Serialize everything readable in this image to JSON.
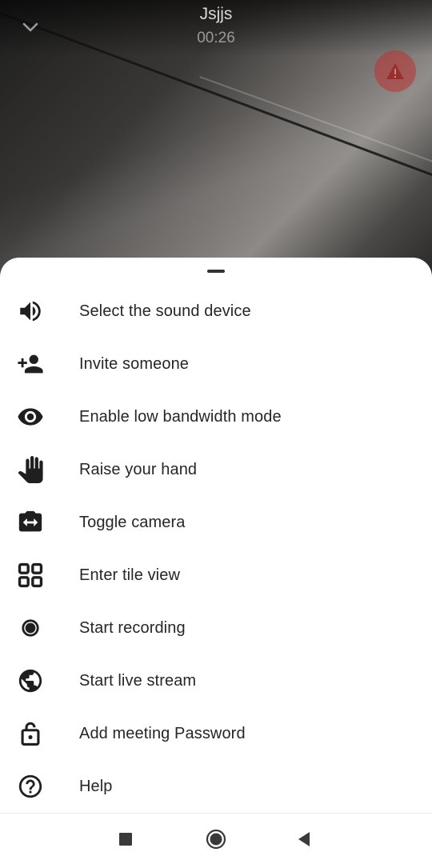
{
  "call": {
    "title": "Jsjjs",
    "timer": "00:26",
    "warning_color": "#be3232"
  },
  "menu": {
    "items": [
      {
        "label": "Select the sound device",
        "icon": "volume-icon"
      },
      {
        "label": "Invite someone",
        "icon": "person-add-icon"
      },
      {
        "label": "Enable low bandwidth mode",
        "icon": "eye-icon"
      },
      {
        "label": "Raise your hand",
        "icon": "hand-icon"
      },
      {
        "label": "Toggle camera",
        "icon": "switch-camera-icon"
      },
      {
        "label": "Enter tile view",
        "icon": "tile-view-icon"
      },
      {
        "label": "Start recording",
        "icon": "record-icon"
      },
      {
        "label": "Start live stream",
        "icon": "globe-icon"
      },
      {
        "label": "Add meeting Password",
        "icon": "lock-icon"
      },
      {
        "label": "Help",
        "icon": "help-icon"
      }
    ]
  },
  "navbar": {
    "buttons": [
      "recents-icon",
      "home-icon",
      "back-icon"
    ]
  }
}
